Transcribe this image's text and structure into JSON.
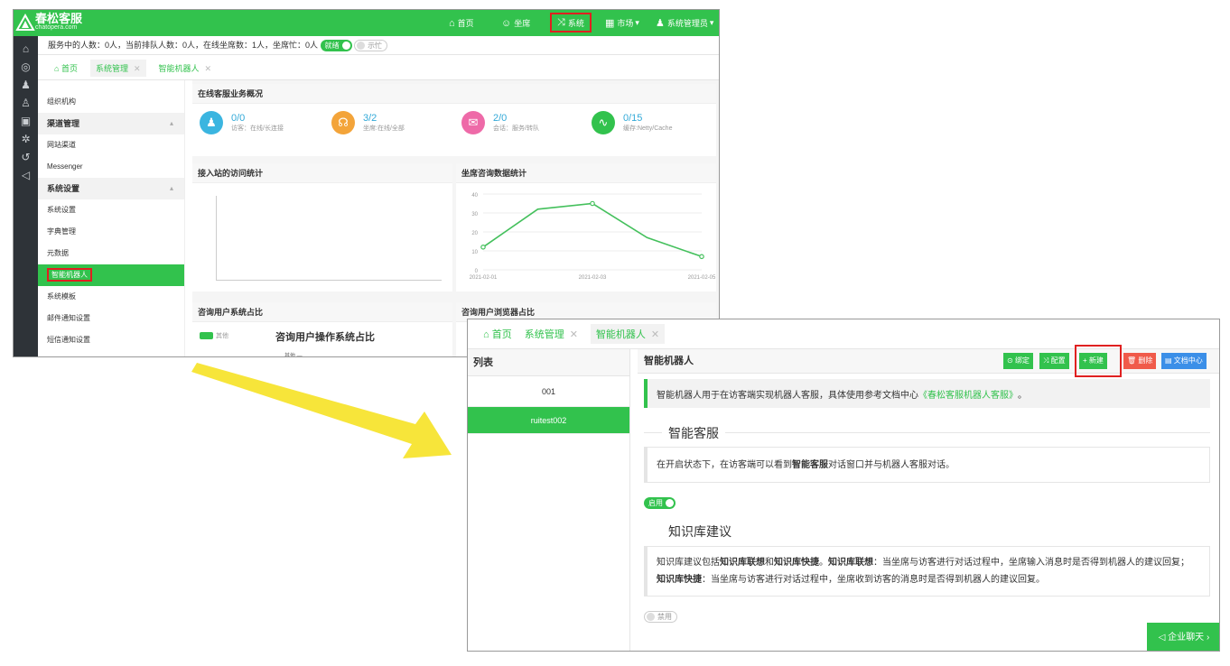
{
  "top": {
    "brand": {
      "name": "春松客服",
      "domain": "chatopera.com"
    },
    "nav": {
      "home": "首页",
      "seat": "坐席",
      "system": "系统",
      "market": "市场",
      "admin": "系统管理员"
    },
    "status": {
      "text": "服务中的人数：0人，当前排队人数：0人，在线坐席数：1人，坐席忙：0人",
      "ready": "就绪",
      "busy": "示忙"
    },
    "tabs": [
      "首页",
      "系统管理",
      "智能机器人"
    ],
    "menu": {
      "org": "组织机构",
      "channel_group": "渠道管理",
      "web": "网站渠道",
      "messenger": "Messenger",
      "settings_group": "系统设置",
      "sysset": "系统设置",
      "dict": "字典管理",
      "meta": "元数据",
      "robot": "智能机器人",
      "template": "系统模板",
      "mail": "邮件通知设置",
      "sms": "短信通知设置"
    },
    "overview": {
      "title": "在线客服业务概况",
      "stats": [
        {
          "value": "0/0",
          "label": "访客：在线/长连接"
        },
        {
          "value": "3/2",
          "label": "坐席:在线/全部"
        },
        {
          "value": "2/0",
          "label": "会话：服务/转队"
        },
        {
          "value": "0/15",
          "label": "缓存:Netty/Cache"
        }
      ]
    },
    "panels": {
      "visits": "接入站的访问统计",
      "seat_stats": "坐席咨询数据统计",
      "os_share": "咨询用户系统占比",
      "browser_share": "咨询用户浏览器占比",
      "os_chart_title": "咨询用户操作系统占比",
      "legend_other": "其他",
      "pie_other": "其他"
    }
  },
  "chart_data": {
    "type": "line",
    "x": [
      "2021-02-01",
      "2021-02-02",
      "2021-02-03",
      "2021-02-04",
      "2021-02-05"
    ],
    "x_ticks": [
      "2021-02-01",
      "2021-02-03",
      "2021-02-05"
    ],
    "y": [
      12,
      32,
      35,
      17,
      7
    ],
    "ylim": [
      0,
      40
    ],
    "y_ticks": [
      "0",
      "10",
      "20",
      "30",
      "40"
    ],
    "series_color": "#44c05c"
  },
  "bottom": {
    "tabs": [
      "首页",
      "系统管理",
      "智能机器人"
    ],
    "list_title": "列表",
    "items": [
      "001",
      "ruitest002"
    ],
    "title": "智能机器人",
    "buttons": {
      "bind": "绑定",
      "config": "配置",
      "new": "+ 新建",
      "delete": "删除",
      "docs": "文档中心"
    },
    "desc_prefix": "智能机器人用于在访客端实现机器人客服，具体使用参考文档中心",
    "desc_link": "《春松客服机器人客服》",
    "desc_suffix": "。",
    "section1": {
      "title": "智能客服",
      "text_a": "在开启状态下，在访客端可以看到",
      "text_bold": "智能客服",
      "text_b": "对话窗口并与机器人客服对话。",
      "toggle": "启用"
    },
    "section2": {
      "title": "知识库建议",
      "l1a": "知识库建议包括",
      "l1b": "知识库联想",
      "l1c": "和",
      "l1d": "知识库快捷",
      "l1e": "。",
      "l1f": "知识库联想",
      "l1g": "：当坐席与访客进行对话过程中，坐席输入消息时是否得到机器人的建议回复；",
      "l2a": "知识库快捷",
      "l2b": "：当坐席与访客进行对话过程中，坐席收到访客的消息时是否得到机器人的建议回复。",
      "toggle": "禁用"
    },
    "chat": "企业聊天"
  },
  "colors": {
    "brand": "#32c24d",
    "highlight": "#e02020",
    "arrow": "#f7e53a",
    "blue": "#3b8fe8",
    "red": "#f05a4a"
  }
}
